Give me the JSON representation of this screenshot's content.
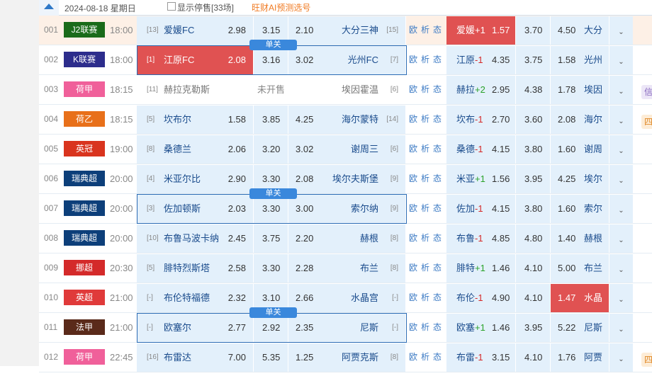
{
  "header": {
    "date": "2024-08-18 星期日",
    "show_suspended": "显示停售[33场]",
    "ai_link": "旺财AI预测选号"
  },
  "links": [
    "欧",
    "析",
    "态"
  ],
  "single_label": "单关",
  "not_on_sale": "未开售",
  "colors": {
    "selected": "#e05252",
    "cell": "#e3f0fb",
    "accent": "#2e78c8"
  },
  "matches": [
    {
      "no": "001",
      "league": "J2联赛",
      "league_color": "#1a6b1a",
      "time": "18:00",
      "home_rank": "[13]",
      "home": "爱媛FC",
      "home_odds": "2.98",
      "draw": "3.15",
      "away_odds": "2.10",
      "away": "大分三神",
      "away_rank": "[15]",
      "hc_team": "爱媛",
      "hc": "+1",
      "hc_home": "1.57",
      "hc_draw": "3.70",
      "hc_away": "4.50",
      "hc_away_team": "大分",
      "sel": "hc_home",
      "peach": true
    },
    {
      "no": "002",
      "league": "K联赛",
      "league_color": "#2d2d8c",
      "time": "18:00",
      "home_rank": "[1]",
      "home": "江原FC",
      "home_odds": "2.08",
      "draw": "3.16",
      "away_odds": "3.02",
      "away": "光州FC",
      "away_rank": "[7]",
      "hc_team": "江原",
      "hc": "-1",
      "hc_home": "4.35",
      "hc_draw": "3.75",
      "hc_away": "1.58",
      "hc_away_team": "光州",
      "sel": "home",
      "single": true
    },
    {
      "no": "003",
      "league": "荷甲",
      "league_color": "#f0609a",
      "time": "18:15",
      "home_rank": "[11]",
      "home": "赫拉克勒斯",
      "away": "埃因霍温",
      "away_rank": "[6]",
      "closed": true,
      "hc_team": "赫拉",
      "hc": "+2",
      "hc_home": "2.95",
      "hc_draw": "4.38",
      "hc_away": "1.78",
      "hc_away_team": "埃因",
      "tag": "信",
      "tag_bg": "#ece6f7",
      "tag_fg": "#8a6cc0"
    },
    {
      "no": "004",
      "league": "荷乙",
      "league_color": "#e8701a",
      "time": "18:15",
      "home_rank": "[5]",
      "home": "坎布尔",
      "home_odds": "1.58",
      "draw": "3.85",
      "away_odds": "4.25",
      "away": "海尔蒙特",
      "away_rank": "[14]",
      "hc_team": "坎布",
      "hc": "-1",
      "hc_home": "2.70",
      "hc_draw": "3.60",
      "hc_away": "2.08",
      "hc_away_team": "海尔",
      "tag": "四",
      "tag_bg": "#fdecd6",
      "tag_fg": "#e08a2a"
    },
    {
      "no": "005",
      "league": "英冠",
      "league_color": "#d9341e",
      "time": "19:00",
      "home_rank": "[8]",
      "home": "桑德兰",
      "home_odds": "2.06",
      "draw": "3.20",
      "away_odds": "3.02",
      "away": "谢周三",
      "away_rank": "[6]",
      "hc_team": "桑德",
      "hc": "-1",
      "hc_home": "4.15",
      "hc_draw": "3.80",
      "hc_away": "1.60",
      "hc_away_team": "谢周"
    },
    {
      "no": "006",
      "league": "瑞典超",
      "league_color": "#0d3f7a",
      "time": "20:00",
      "home_rank": "[4]",
      "home": "米亚尔比",
      "home_odds": "2.90",
      "draw": "3.30",
      "away_odds": "2.08",
      "away": "埃尔夫斯堡",
      "away_rank": "[9]",
      "hc_team": "米亚",
      "hc": "+1",
      "hc_home": "1.56",
      "hc_draw": "3.95",
      "hc_away": "4.25",
      "hc_away_team": "埃尔"
    },
    {
      "no": "007",
      "league": "瑞典超",
      "league_color": "#0d3f7a",
      "time": "20:00",
      "home_rank": "[3]",
      "home": "佐加顿斯",
      "home_odds": "2.03",
      "draw": "3.30",
      "away_odds": "3.00",
      "away": "索尔纳",
      "away_rank": "[9]",
      "hc_team": "佐加",
      "hc": "-1",
      "hc_home": "4.15",
      "hc_draw": "3.80",
      "hc_away": "1.60",
      "hc_away_team": "索尔",
      "single": true
    },
    {
      "no": "008",
      "league": "瑞典超",
      "league_color": "#0d3f7a",
      "time": "20:00",
      "home_rank": "[10]",
      "home": "布鲁马波卡纳",
      "home_odds": "2.45",
      "draw": "3.75",
      "away_odds": "2.20",
      "away": "赫根",
      "away_rank": "[8]",
      "hc_team": "布鲁",
      "hc": "-1",
      "hc_home": "4.85",
      "hc_draw": "4.80",
      "hc_away": "1.40",
      "hc_away_team": "赫根"
    },
    {
      "no": "009",
      "league": "挪超",
      "league_color": "#d42a2a",
      "time": "20:30",
      "home_rank": "[5]",
      "home": "腓特烈斯塔",
      "home_odds": "2.58",
      "draw": "3.30",
      "away_odds": "2.28",
      "away": "布兰",
      "away_rank": "[8]",
      "hc_team": "腓特",
      "hc": "+1",
      "hc_home": "1.46",
      "hc_draw": "4.10",
      "hc_away": "5.00",
      "hc_away_team": "布兰"
    },
    {
      "no": "010",
      "league": "英超",
      "league_color": "#e03a3a",
      "time": "21:00",
      "home_rank": "[-]",
      "home": "布伦特福德",
      "home_odds": "2.32",
      "draw": "3.10",
      "away_odds": "2.66",
      "away": "水晶宫",
      "away_rank": "[-]",
      "hc_team": "布伦",
      "hc": "-1",
      "hc_home": "4.90",
      "hc_draw": "4.10",
      "hc_away": "1.47",
      "hc_away_team": "水晶",
      "sel": "hc_away"
    },
    {
      "no": "011",
      "league": "法甲",
      "league_color": "#5a2a1a",
      "time": "21:00",
      "home_rank": "[-]",
      "home": "欧塞尔",
      "home_odds": "2.77",
      "draw": "2.92",
      "away_odds": "2.35",
      "away": "尼斯",
      "away_rank": "[-]",
      "hc_team": "欧塞",
      "hc": "+1",
      "hc_home": "1.46",
      "hc_draw": "3.95",
      "hc_away": "5.22",
      "hc_away_team": "尼斯",
      "single": true
    },
    {
      "no": "012",
      "league": "荷甲",
      "league_color": "#f0609a",
      "time": "22:45",
      "home_rank": "[16]",
      "home": "布雷达",
      "home_odds": "7.00",
      "draw": "5.35",
      "away_odds": "1.25",
      "away": "阿贾克斯",
      "away_rank": "[8]",
      "hc_team": "布雷",
      "hc": "-1",
      "hc_home": "3.15",
      "hc_draw": "4.10",
      "hc_away": "1.76",
      "hc_away_team": "阿贾",
      "tag": "四",
      "tag_bg": "#fdecd6",
      "tag_fg": "#e08a2a"
    }
  ]
}
